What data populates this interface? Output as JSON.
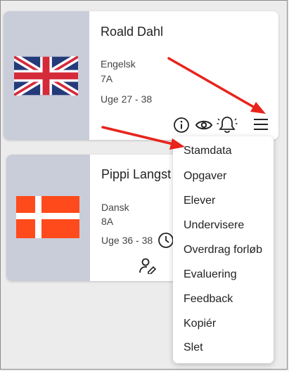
{
  "cards": [
    {
      "title": "Roald Dahl",
      "subject": "Engelsk",
      "class": "7A",
      "weeks": "Uge 27 - 38",
      "flag": "uk-flag",
      "actions": [
        "info-icon",
        "eye-icon",
        "bell-icon",
        "hamburger-menu-icon"
      ]
    },
    {
      "title": "Pippi Langst",
      "subject": "Dansk",
      "class": "8A",
      "weeks": "Uge 36 - 38",
      "flag": "danish-flag",
      "actions": [
        "clock-icon",
        "user-edit-icon"
      ]
    }
  ],
  "menu": {
    "items": [
      "Stamdata",
      "Opgaver",
      "Elever",
      "Undervisere",
      "Overdrag forløb",
      "Evaluering",
      "Feedback",
      "Kopiér",
      "Slet"
    ]
  },
  "colors": {
    "card_side": "#c9ccd9",
    "annotation_arrow": "#e8231c",
    "danish_flag_red": "#ff4a1c",
    "uk_blue": "#243b7a",
    "uk_red": "#d42a3a"
  }
}
